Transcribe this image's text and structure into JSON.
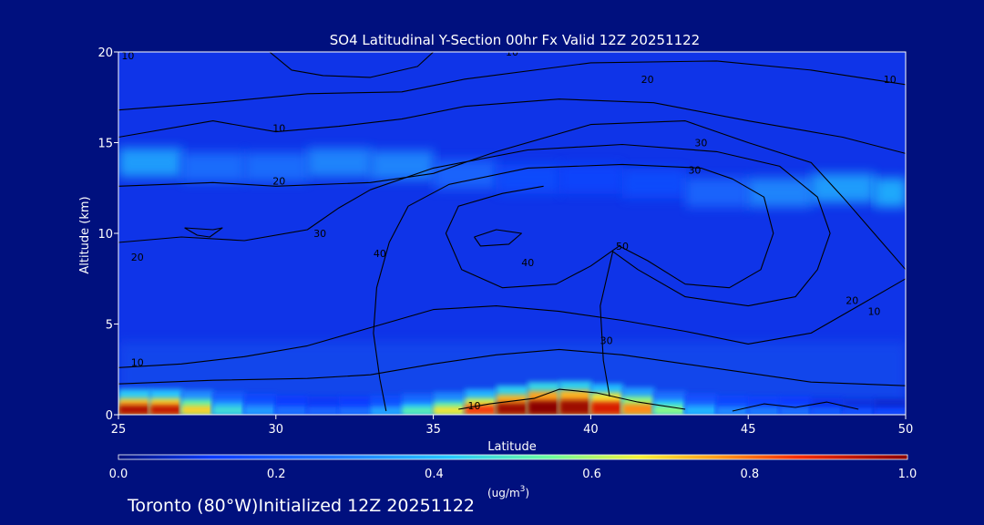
{
  "chart_data": {
    "type": "heatmap",
    "title": "SO4 Latitudinal Y-Section 00hr  Fx Valid 12Z 20251122",
    "xlabel": "Latitude",
    "ylabel": "Altitude (km)",
    "xlim": [
      25,
      50
    ],
    "ylim": [
      0,
      20
    ],
    "x_ticks": [
      "25",
      "30",
      "35",
      "40",
      "45",
      "50"
    ],
    "y_ticks": [
      "0",
      "5",
      "10",
      "15",
      "20"
    ],
    "colorbar": {
      "label_main": "(ug/m",
      "label_sup": "3",
      "label_end": ")",
      "range": [
        0.0,
        1.0
      ],
      "ticks": [
        "0.0",
        "0.2",
        "0.4",
        "0.6",
        "0.8",
        "1.0"
      ]
    },
    "surface_concentration": {
      "x": [
        25,
        26,
        27,
        28,
        29,
        30,
        31,
        32,
        33,
        34,
        35,
        36,
        37,
        38,
        39,
        40,
        41,
        42,
        43,
        44,
        45,
        46,
        47,
        48,
        49,
        50
      ],
      "peak_value": [
        0.9,
        1.0,
        0.85,
        0.55,
        0.4,
        0.3,
        0.25,
        0.25,
        0.3,
        0.45,
        0.6,
        0.75,
        0.95,
        1.0,
        1.0,
        0.95,
        0.85,
        0.7,
        0.45,
        0.35,
        0.3,
        0.3,
        0.25,
        0.2,
        0.2,
        0.15
      ],
      "depth_km": [
        0.9,
        0.9,
        0.9,
        0.8,
        0.7,
        0.6,
        0.5,
        0.5,
        0.5,
        0.6,
        0.7,
        0.8,
        1.0,
        1.2,
        1.4,
        1.3,
        1.1,
        0.9,
        0.7,
        0.6,
        0.5,
        0.5,
        0.5,
        0.4,
        0.4,
        0.4
      ]
    },
    "upper_layer": {
      "x": [
        25,
        27,
        29,
        31,
        33,
        35,
        37,
        39,
        41,
        43,
        45,
        47,
        49,
        50
      ],
      "alt_km": [
        14.0,
        13.8,
        13.5,
        13.8,
        14.0,
        13.5,
        13.0,
        13.0,
        13.0,
        12.5,
        12.0,
        12.5,
        12.5,
        12.0
      ],
      "value": [
        0.45,
        0.3,
        0.25,
        0.3,
        0.35,
        0.3,
        0.2,
        0.15,
        0.15,
        0.2,
        0.3,
        0.35,
        0.4,
        0.4
      ]
    },
    "contour_labels": [
      {
        "text": "10",
        "lat": 25.3,
        "alt": 19.6
      },
      {
        "text": "10",
        "lat": 37.5,
        "alt": 19.8
      },
      {
        "text": "20",
        "lat": 41.8,
        "alt": 18.3
      },
      {
        "text": "10",
        "lat": 49.5,
        "alt": 18.3
      },
      {
        "text": "10",
        "lat": 30.1,
        "alt": 15.6
      },
      {
        "text": "30",
        "lat": 43.5,
        "alt": 14.8
      },
      {
        "text": "20",
        "lat": 30.1,
        "alt": 12.7
      },
      {
        "text": "30",
        "lat": 43.3,
        "alt": 13.3
      },
      {
        "text": "20",
        "lat": 25.6,
        "alt": 8.5
      },
      {
        "text": "30",
        "lat": 31.4,
        "alt": 9.8
      },
      {
        "text": "40",
        "lat": 33.3,
        "alt": 8.7
      },
      {
        "text": "50",
        "lat": 41.0,
        "alt": 9.1
      },
      {
        "text": "40",
        "lat": 38.0,
        "alt": 8.2
      },
      {
        "text": "20",
        "lat": 48.3,
        "alt": 6.1
      },
      {
        "text": "10",
        "lat": 49.0,
        "alt": 5.5
      },
      {
        "text": "30",
        "lat": 40.5,
        "alt": 3.9
      },
      {
        "text": "10",
        "lat": 25.6,
        "alt": 2.7
      },
      {
        "text": "10",
        "lat": 36.3,
        "alt": 0.3
      }
    ]
  },
  "footer": {
    "station": "Toronto (80°W)Initialized 12Z 20251122"
  }
}
